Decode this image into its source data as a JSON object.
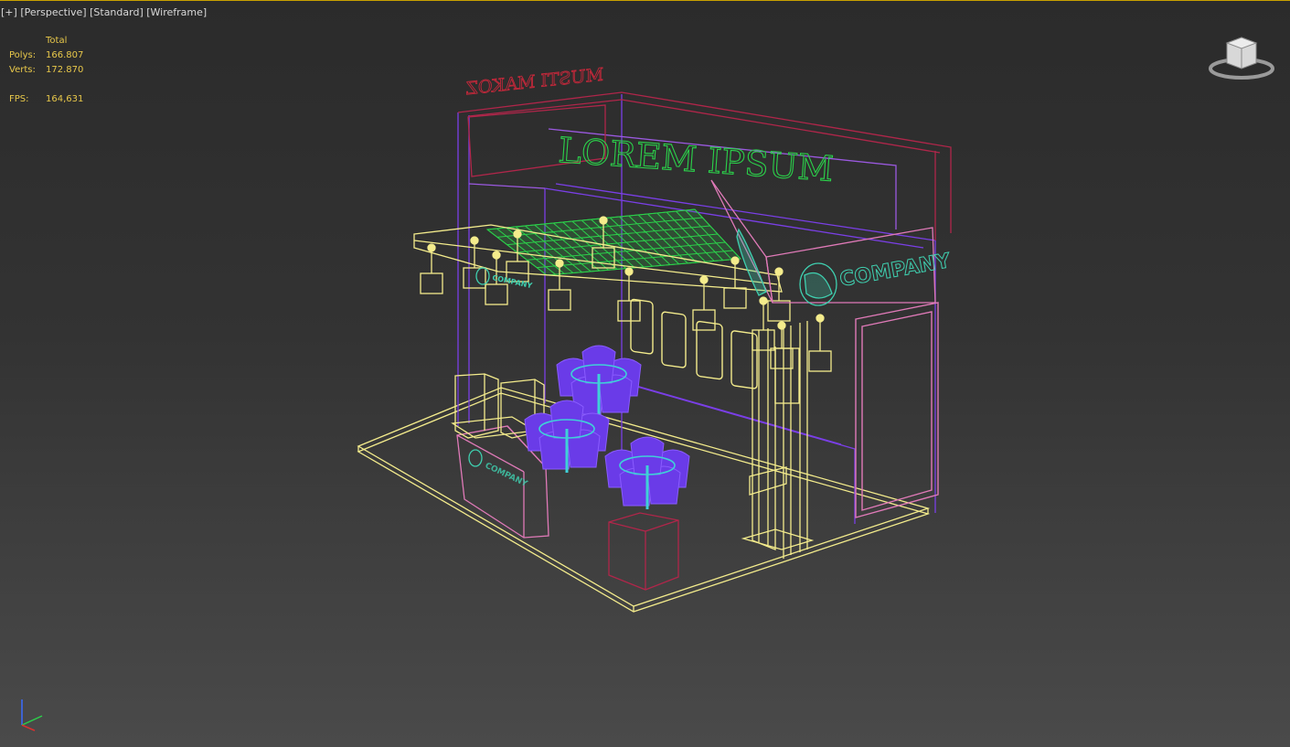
{
  "viewport": {
    "labels": {
      "plus": "[+]",
      "view": "[Perspective]",
      "shading_standard": "[Standard]",
      "shading_mode": "[Wireframe]"
    },
    "stats": {
      "header": "Total",
      "polys_label": "Polys:",
      "polys_value": "166.807",
      "verts_label": "Verts:",
      "verts_value": "172.870",
      "fps_label": "FPS:",
      "fps_value": "164,631"
    },
    "scene_text": {
      "headline": "LOREM IPSUM",
      "mirrored_sign": "MUSTI MAKOZ",
      "company_sign": "COMPANY",
      "counter_sign": "COMPANY",
      "small_sign": "COMPANY"
    },
    "viewcube_icon": "viewcube-icon",
    "axis_icon": "xyz-axis-tripod-icon"
  },
  "colors": {
    "accent_border": "#c8a000",
    "stats_text": "#e8c84a",
    "wire_yellow": "#f4ec8c",
    "wire_purple": "#7a3fe6",
    "wire_pink": "#e07ab8",
    "wire_red": "#b0264a",
    "wire_green": "#2bd04a",
    "wire_teal": "#3fd0b0",
    "chair_blue": "#6a3be8"
  }
}
